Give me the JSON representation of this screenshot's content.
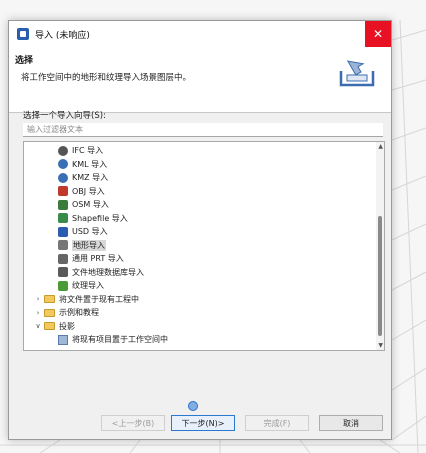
{
  "window": {
    "title": "导入 (未响应)",
    "close_symbol": "✕"
  },
  "header": {
    "title": "选择",
    "description": "将工作空间中的地形和纹理导入场景图层中。"
  },
  "wizard": {
    "prompt": "选择一个导入向导(S):",
    "filter_placeholder": "输入过滤器文本",
    "items": [
      {
        "label": "IFC 导入",
        "icon": "ifc-icon",
        "color": "#555555"
      },
      {
        "label": "KML 导入",
        "icon": "globe-icon",
        "color": "#3b6fb5"
      },
      {
        "label": "KMZ 导入",
        "icon": "globe-icon",
        "color": "#3b6fb5"
      },
      {
        "label": "OBJ 导入",
        "icon": "obj-icon",
        "color": "#c0392b"
      },
      {
        "label": "OSM 导入",
        "icon": "search-icon",
        "color": "#3a7a3a"
      },
      {
        "label": "Shapefile 导入",
        "icon": "shapefile-icon",
        "color": "#3a8a4a"
      },
      {
        "label": "USD 导入",
        "icon": "usd-icon",
        "color": "#2a5db0"
      },
      {
        "label": "地形导入",
        "icon": "terrain-icon",
        "color": "#777777",
        "selected": true
      },
      {
        "label": "通用 PRT 导入",
        "icon": "prt-icon",
        "color": "#666666"
      },
      {
        "label": "文件地理数据库导入",
        "icon": "database-icon",
        "color": "#5a5a5a"
      },
      {
        "label": "纹理导入",
        "icon": "texture-icon",
        "color": "#4a9a3a"
      }
    ],
    "folders": [
      {
        "label": "将文件置于现有工程中",
        "state": "collapsed"
      },
      {
        "label": "示例和教程",
        "state": "collapsed"
      },
      {
        "label": "投影",
        "state": "expanded"
      }
    ],
    "child": {
      "label": "将现有项目置于工作空间中"
    }
  },
  "buttons": {
    "back": "<上一步(B)",
    "next": "下一步(N)>",
    "finish": "完成(F)",
    "cancel": "取消"
  }
}
